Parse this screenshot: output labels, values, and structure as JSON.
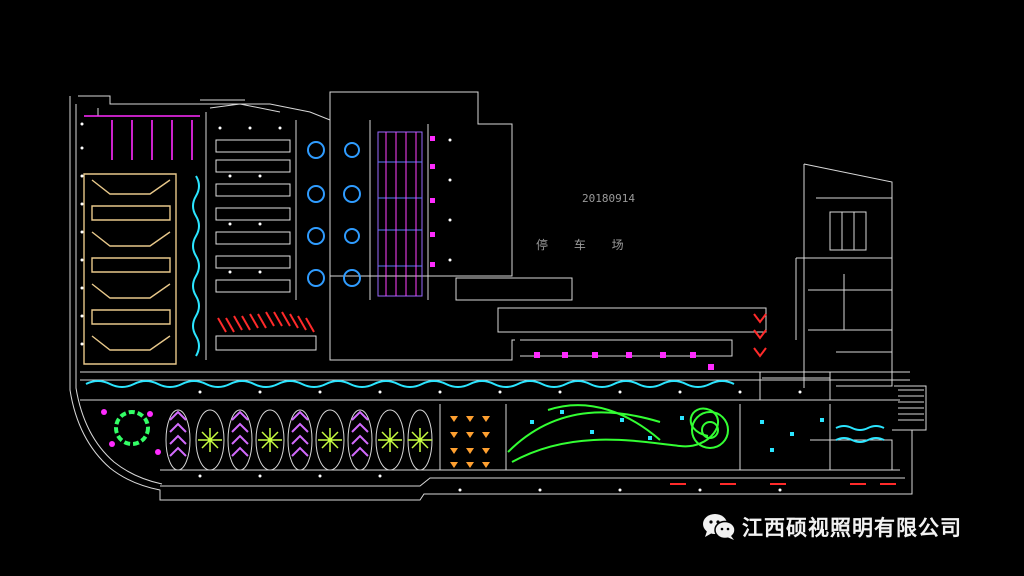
{
  "drawing": {
    "date_code": "20180914",
    "parking_label": "停 车 场"
  },
  "watermark": {
    "icon": "wechat-icon",
    "text": "江西硕视照明有限公司"
  },
  "colors": {
    "background": "#000000",
    "walls": "#dcdcdc",
    "lights": "#ffffff",
    "magenta": "#ff00ff",
    "cyan": "#00e5ff",
    "green": "#33ff33",
    "red": "#ff2a2a",
    "orange": "#ffa030",
    "yellow_green": "#c8ff40",
    "tan": "#e8c88a",
    "blue": "#2f8cff",
    "violet": "#cc66ff"
  }
}
